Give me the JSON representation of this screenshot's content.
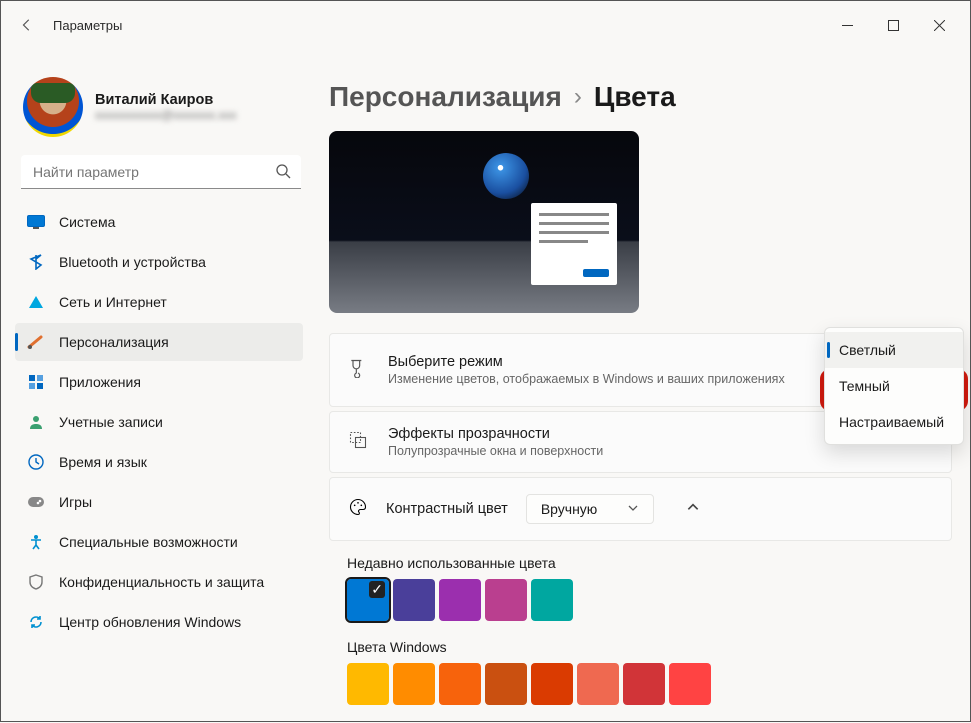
{
  "window": {
    "title": "Параметры"
  },
  "profile": {
    "name": "Виталий Каиров",
    "email": "xxxxxxxxxxx@xxxxxxx.xxx"
  },
  "search": {
    "placeholder": "Найти параметр"
  },
  "nav": {
    "items": [
      {
        "label": "Система",
        "icon": "system"
      },
      {
        "label": "Bluetooth и устройства",
        "icon": "bluetooth"
      },
      {
        "label": "Сеть и Интернет",
        "icon": "network"
      },
      {
        "label": "Персонализация",
        "icon": "personalization"
      },
      {
        "label": "Приложения",
        "icon": "apps"
      },
      {
        "label": "Учетные записи",
        "icon": "accounts"
      },
      {
        "label": "Время и язык",
        "icon": "time"
      },
      {
        "label": "Игры",
        "icon": "gaming"
      },
      {
        "label": "Специальные возможности",
        "icon": "accessibility"
      },
      {
        "label": "Конфиденциальность и защита",
        "icon": "privacy"
      },
      {
        "label": "Центр обновления Windows",
        "icon": "update"
      }
    ],
    "active_index": 3
  },
  "breadcrumb": {
    "parent": "Персонализация",
    "current": "Цвета"
  },
  "settings": {
    "mode": {
      "title": "Выберите режим",
      "desc": "Изменение цветов, отображаемых в Windows и ваших приложениях",
      "options": [
        "Светлый",
        "Темный",
        "Настраиваемый"
      ],
      "selected_index": 0,
      "highlighted_index": 1
    },
    "transparency": {
      "title": "Эффекты прозрачности",
      "desc": "Полупрозрачные окна и поверхности"
    },
    "accent": {
      "title": "Контрастный цвет",
      "selector_value": "Вручную"
    },
    "recent_colors": {
      "label": "Недавно использованные цвета",
      "colors": [
        "#0078d4",
        "#4a3f9a",
        "#9b2fae",
        "#ba3f8f",
        "#00a7a0"
      ],
      "selected_index": 0
    },
    "windows_colors": {
      "label": "Цвета Windows",
      "colors": [
        "#ffb900",
        "#ff8c00",
        "#f7630c",
        "#ca5010",
        "#da3b01",
        "#ef6950",
        "#d13438",
        "#ff4343"
      ]
    }
  }
}
